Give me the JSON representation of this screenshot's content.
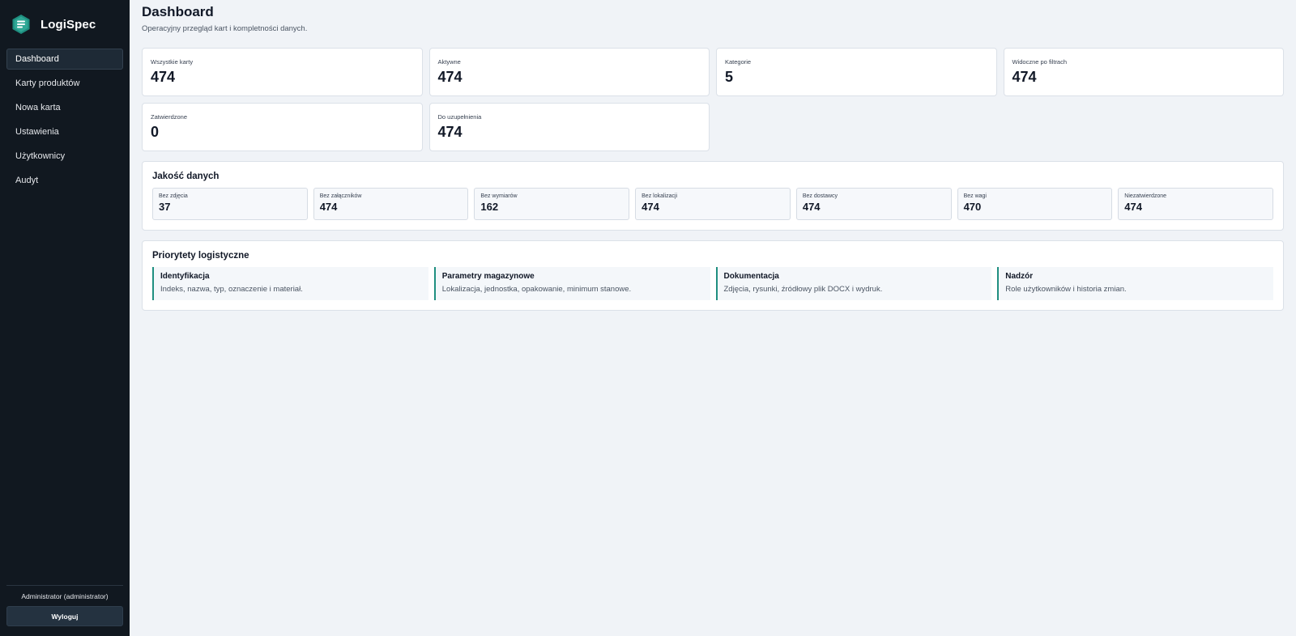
{
  "brand": {
    "name": "LogiSpec"
  },
  "nav": [
    {
      "label": "Dashboard"
    },
    {
      "label": "Karty produktów"
    },
    {
      "label": "Nowa karta"
    },
    {
      "label": "Ustawienia"
    },
    {
      "label": "Użytkownicy"
    },
    {
      "label": "Audyt"
    }
  ],
  "user": {
    "label": "Administrator (administrator)",
    "logout_label": "Wyloguj"
  },
  "header": {
    "title": "Dashboard",
    "subtitle": "Operacyjny przegląd kart i kompletności danych."
  },
  "stats": [
    {
      "label": "Wszystkie karty",
      "value": "474"
    },
    {
      "label": "Aktywne",
      "value": "474"
    },
    {
      "label": "Kategorie",
      "value": "5"
    },
    {
      "label": "Widoczne po filtrach",
      "value": "474"
    },
    {
      "label": "Zatwierdzone",
      "value": "0"
    },
    {
      "label": "Do uzupełnienia",
      "value": "474"
    }
  ],
  "quality": {
    "title": "Jakość danych",
    "items": [
      {
        "label": "Bez zdjęcia",
        "value": "37"
      },
      {
        "label": "Bez załączników",
        "value": "474"
      },
      {
        "label": "Bez wymiarów",
        "value": "162"
      },
      {
        "label": "Bez lokalizacji",
        "value": "474"
      },
      {
        "label": "Bez dostawcy",
        "value": "474"
      },
      {
        "label": "Bez wagi",
        "value": "470"
      },
      {
        "label": "Niezatwierdzone",
        "value": "474"
      }
    ]
  },
  "priorities": {
    "title": "Priorytety logistyczne",
    "items": [
      {
        "title": "Identyfikacja",
        "desc": "Indeks, nazwa, typ, oznaczenie i materiał."
      },
      {
        "title": "Parametry magazynowe",
        "desc": "Lokalizacja, jednostka, opakowanie, minimum stanowe."
      },
      {
        "title": "Dokumentacja",
        "desc": "Zdjęcia, rysunki, źródłowy plik DOCX i wydruk."
      },
      {
        "title": "Nadzór",
        "desc": "Role użytkowników i historia zmian."
      }
    ]
  },
  "colors": {
    "sidebar_bg": "#111820",
    "page_bg": "#f0f3f7",
    "accent": "#1f8f80"
  }
}
